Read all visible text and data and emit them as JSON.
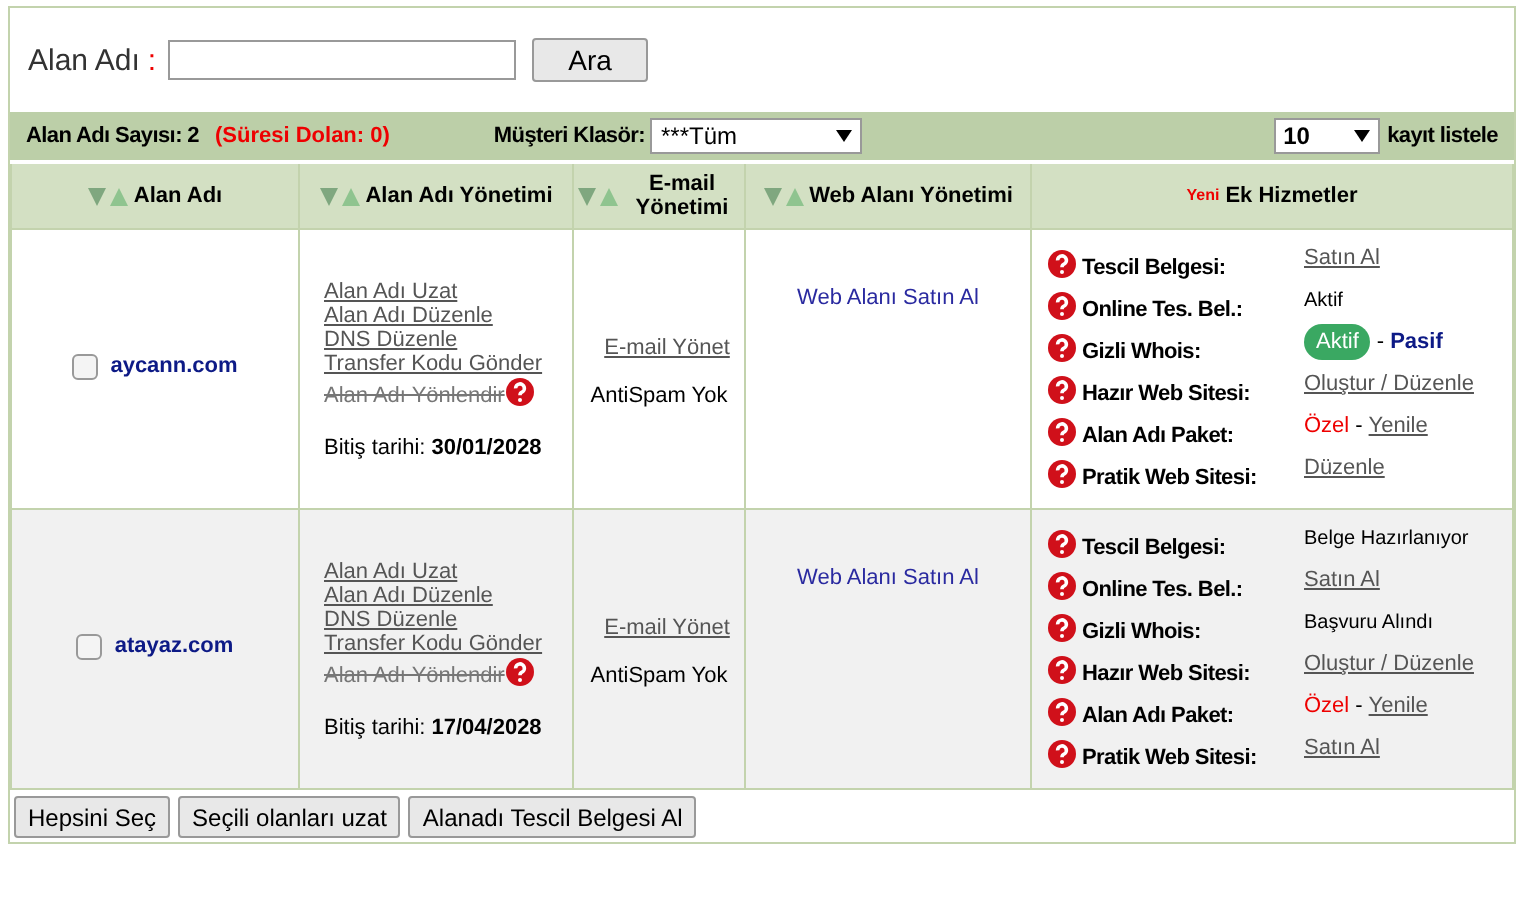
{
  "search": {
    "label": "Alan Adı",
    "colon": ":",
    "button": "Ara"
  },
  "toolbar": {
    "count_label": "Alan Adı Sayısı: 2",
    "expired": "(Süresi Dolan: 0)",
    "folder_label": "Müşteri Klasör:",
    "folder_value": "***Tüm",
    "page_size": "10",
    "page_size_label": "kayıt listele"
  },
  "columns": [
    {
      "label": "Alan Adı",
      "sortable": true
    },
    {
      "label": "Alan Adı Yönetimi",
      "sortable": true
    },
    {
      "label": "E-mail Yönetimi",
      "sortable": true
    },
    {
      "label": "Web Alanı Yönetimi",
      "sortable": true
    },
    {
      "label": "Ek Hizmetler",
      "badge": "Yeni",
      "sortable": false
    }
  ],
  "rows": [
    {
      "checked": false,
      "domain": "aycann.com",
      "actions": [
        {
          "label": "Alan Adı Uzat",
          "disabled": false
        },
        {
          "label": "Alan Adı Düzenle",
          "disabled": false
        },
        {
          "label": "DNS Düzenle",
          "disabled": false
        },
        {
          "label": "Transfer Kodu Gönder",
          "disabled": false
        },
        {
          "label": "Alan Adı Yönlendir",
          "disabled": true
        }
      ],
      "expiry_label": "Bitiş tarihi:",
      "expiry": "30/01/2028",
      "email_link": "E-mail Yönet",
      "antispam": "AntiSpam Yok",
      "web_link": "Web Alanı Satın Al",
      "services": [
        {
          "label": "Tescil Belgesi:",
          "value": [
            {
              "kind": "link",
              "text": "Satın Al"
            }
          ]
        },
        {
          "label": "Online Tes. Bel.:",
          "value": [
            {
              "kind": "plain",
              "text": "Aktif"
            }
          ]
        },
        {
          "label": "Gizli Whois:",
          "value": [
            {
              "kind": "pill",
              "text": "Aktif"
            },
            {
              "kind": "sep",
              "text": "-"
            },
            {
              "kind": "strong",
              "text": "Pasif"
            }
          ]
        },
        {
          "label": "Hazır Web Sitesi:",
          "value": [
            {
              "kind": "link",
              "text": "Oluştur / Düzenle"
            }
          ]
        },
        {
          "label": "Alan Adı Paket:",
          "value": [
            {
              "kind": "red",
              "text": "Özel"
            },
            {
              "kind": "sep",
              "text": "-"
            },
            {
              "kind": "link",
              "text": "Yenile"
            }
          ]
        },
        {
          "label": "Pratik Web Sitesi:",
          "value": [
            {
              "kind": "link",
              "text": "Düzenle"
            }
          ]
        }
      ]
    },
    {
      "checked": false,
      "domain": "atayaz.com",
      "actions": [
        {
          "label": "Alan Adı Uzat",
          "disabled": false
        },
        {
          "label": "Alan Adı Düzenle",
          "disabled": false
        },
        {
          "label": "DNS Düzenle",
          "disabled": false
        },
        {
          "label": "Transfer Kodu Gönder",
          "disabled": false
        },
        {
          "label": "Alan Adı Yönlendir",
          "disabled": true
        }
      ],
      "expiry_label": "Bitiş tarihi:",
      "expiry": "17/04/2028",
      "email_link": "E-mail Yönet",
      "antispam": "AntiSpam Yok",
      "web_link": "Web Alanı Satın Al",
      "services": [
        {
          "label": "Tescil Belgesi:",
          "value": [
            {
              "kind": "plain",
              "text": "Belge Hazırlanıyor"
            }
          ]
        },
        {
          "label": "Online Tes. Bel.:",
          "value": [
            {
              "kind": "link",
              "text": "Satın Al"
            }
          ]
        },
        {
          "label": "Gizli Whois:",
          "value": [
            {
              "kind": "plain",
              "text": "Başvuru Alındı"
            }
          ]
        },
        {
          "label": "Hazır Web Sitesi:",
          "value": [
            {
              "kind": "link",
              "text": "Oluştur / Düzenle"
            }
          ]
        },
        {
          "label": "Alan Adı Paket:",
          "value": [
            {
              "kind": "red",
              "text": "Özel"
            },
            {
              "kind": "sep",
              "text": "-"
            },
            {
              "kind": "link",
              "text": "Yenile"
            }
          ]
        },
        {
          "label": "Pratik Web Sitesi:",
          "value": [
            {
              "kind": "link",
              "text": "Satın Al"
            }
          ]
        }
      ]
    }
  ],
  "buttons": [
    "Hepsini Seç",
    "Seçili olanları uzat",
    "Alanadı Tescil Belgesi Al"
  ]
}
